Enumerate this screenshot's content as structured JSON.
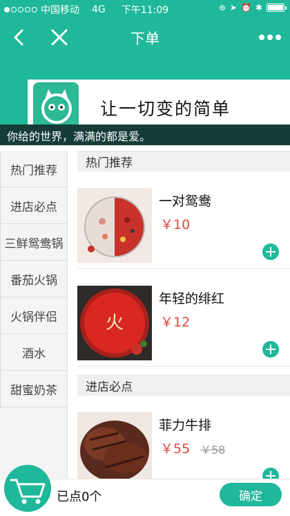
{
  "status_bar": {
    "carrier": "中国移动",
    "network": "4G",
    "time": "下午11:09",
    "signal_dots_filled": 1,
    "battery_level": 1.0
  },
  "navbar": {
    "title": "下单",
    "back_icon": "chevron-left-icon",
    "close_icon": "close-icon",
    "more_icon": "more-dots-icon"
  },
  "banner": {
    "slogan": "让一切变的简单",
    "caption": "你给的世界，满满的都是爱。"
  },
  "categories": [
    {
      "label": "热门推荐"
    },
    {
      "label": "进店必点"
    },
    {
      "label": "三鲜鸳鸯锅"
    },
    {
      "label": "番茄火锅"
    },
    {
      "label": "火锅伴侣"
    },
    {
      "label": "酒水"
    },
    {
      "label": "甜蜜奶茶"
    }
  ],
  "sections": [
    {
      "title": "热门推荐",
      "items": [
        {
          "name": "一对鸳鸯",
          "price": "￥10"
        },
        {
          "name": "年轻的绯红",
          "price": "￥12"
        }
      ]
    },
    {
      "title": "进店必点",
      "items": [
        {
          "name": "菲力牛排",
          "price": "￥55",
          "old_price": "￥58"
        }
      ]
    }
  ],
  "bottom": {
    "cart_count_text": "已点0个",
    "confirm_label": "确定"
  },
  "colors": {
    "accent": "#1fb89a",
    "price": "#e0443d",
    "caption_bg": "#153c38"
  }
}
